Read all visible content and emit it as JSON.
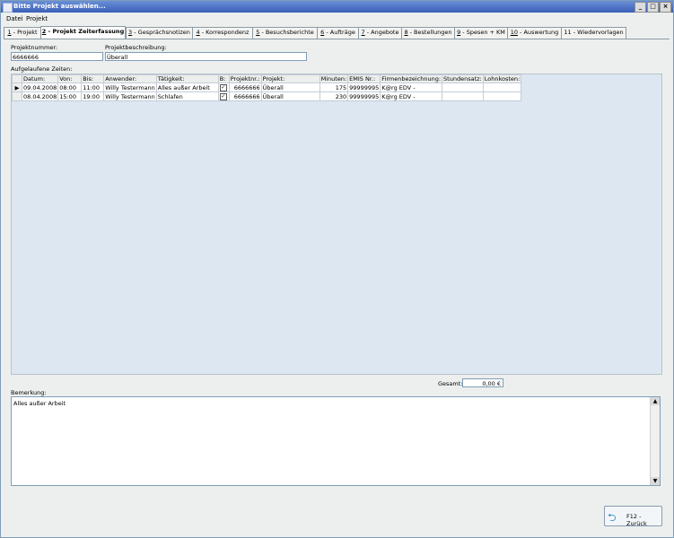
{
  "window": {
    "title": "Bitte Projekt auswählen...",
    "buttons": [
      "_",
      "□",
      "×"
    ]
  },
  "menu": [
    "Datei",
    "Projekt"
  ],
  "tabs": [
    {
      "num": "1",
      "label": " - Projekt"
    },
    {
      "num": "2",
      "label": " - Projekt Zeiterfassung"
    },
    {
      "num": "3",
      "label": " - Gesprächsnotizen"
    },
    {
      "num": "4",
      "label": " - Korrespondenz"
    },
    {
      "num": "5",
      "label": " - Besuchsberichte"
    },
    {
      "num": "6",
      "label": " - Aufträge"
    },
    {
      "num": "7",
      "label": " - Angebote"
    },
    {
      "num": "8",
      "label": " - Bestellungen"
    },
    {
      "num": "9",
      "label": " - Spesen + KM"
    },
    {
      "num": "10",
      "label": " - Auswertung"
    },
    {
      "num": "11",
      "label": " - Wiedervorlagen"
    }
  ],
  "form": {
    "projektnummer_label": "Projektnummer:",
    "projektnummer_value": "6666666",
    "beschreibung_label": "Projektbeschreibung:",
    "beschreibung_value": "Überall",
    "zeiten_label": "Aufgelaufene Zeiten:"
  },
  "grid": {
    "headers": [
      "Datum:",
      "Von:",
      "Bis:",
      "Anwender:",
      "Tätigkeit:",
      "B:",
      "Projektnr.:",
      "Projekt:",
      "Minuten:",
      "EMIS Nr.:",
      "Firmenbezeichnung:",
      "Stundensatz:",
      "Lohnkosten:"
    ],
    "rows": [
      {
        "datum": "09.04.2008",
        "von": "08:00",
        "bis": "11:00",
        "anwender": "Willy Testermann",
        "taetigkeit": "Alles außer Arbeit",
        "b": "✓",
        "projektnr": "6666666",
        "projekt": "Überall",
        "minuten": "175",
        "emis": "99999995",
        "firma": "K@rg EDV -",
        "stundensatz": "",
        "lohnkosten": ""
      },
      {
        "datum": "08.04.2008",
        "von": "15:00",
        "bis": "19:00",
        "anwender": "Willy Testermann",
        "taetigkeit": "Schlafen",
        "b": "✓",
        "projektnr": "6666666",
        "projekt": "Überall",
        "minuten": "230",
        "emis": "99999995",
        "firma": "K@rg EDV -",
        "stundensatz": "",
        "lohnkosten": ""
      }
    ]
  },
  "totals": {
    "label": "Gesamt:",
    "value": "0,00 €"
  },
  "remark": {
    "label": "Bemerkung:",
    "text": "Alles außer Arbeit"
  },
  "back_button": {
    "label": "F12 - Zurück"
  }
}
